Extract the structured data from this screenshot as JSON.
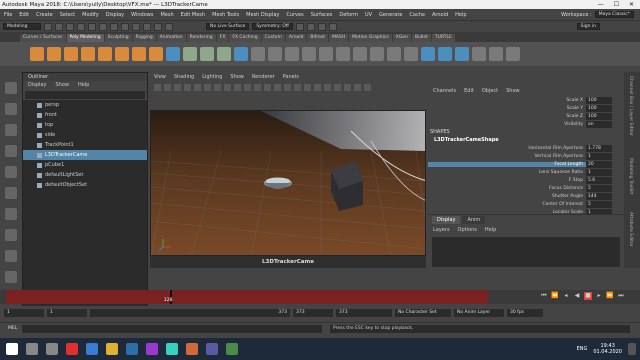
{
  "window_title": "Autodesk Maya 2018: C:\\Users\\yully\\Desktop\\VFX.ma*  ---  L3DTrackerCame",
  "window_controls": [
    "—",
    "☐",
    "✕"
  ],
  "menus": [
    "File",
    "Edit",
    "Create",
    "Select",
    "Modify",
    "Display",
    "Windows",
    "Mesh",
    "Edit Mesh",
    "Mesh Tools",
    "Mesh Display",
    "Curves",
    "Surfaces",
    "Deform",
    "UV",
    "Generate",
    "Cache",
    "Arnold",
    "Help"
  ],
  "workspace_label": "Workspace :",
  "workspace_value": "Maya Classic*",
  "mode_select": "Modeling",
  "live_surface": "No Live Surface",
  "symmetry": "Symmetry: Off",
  "signin": "Sign in",
  "shelf_tabs": [
    "Curves / Surfaces",
    "Poly Modeling",
    "Sculpting",
    "Rigging",
    "Animation",
    "Rendering",
    "FX",
    "FX Caching",
    "Custom",
    "Arnold",
    "Bifrost",
    "MASH",
    "Motion Graphics",
    "XGen",
    "Bullet",
    "TURTLE"
  ],
  "shelf_active": "Poly Modeling",
  "outliner": {
    "title": "Outliner",
    "menu": [
      "Display",
      "Show",
      "Help"
    ],
    "items": [
      {
        "label": "persp",
        "selected": false
      },
      {
        "label": "front",
        "selected": false
      },
      {
        "label": "top",
        "selected": false
      },
      {
        "label": "side",
        "selected": false
      },
      {
        "label": "TrackPoint1",
        "selected": false
      },
      {
        "label": "L3DTrackerCame",
        "selected": true
      },
      {
        "label": "pCube1",
        "selected": false
      },
      {
        "label": "defaultLightSet",
        "selected": false
      },
      {
        "label": "defaultObjectSet",
        "selected": false
      }
    ]
  },
  "viewport": {
    "menu": [
      "View",
      "Shading",
      "Lighting",
      "Show",
      "Renderer",
      "Panels"
    ],
    "camera_label": "L3DTrackerCame"
  },
  "channel_box": {
    "menu": [
      "Channels",
      "Edit",
      "Object",
      "Show"
    ],
    "transform_rows": [
      {
        "label": "Scale X",
        "value": "100"
      },
      {
        "label": "Scale Y",
        "value": "100"
      },
      {
        "label": "Scale Z",
        "value": "100"
      },
      {
        "label": "Visibility",
        "value": "on"
      }
    ],
    "shapes_label": "SHAPES",
    "shape_node": "L3DTrackerCameShape",
    "shape_rows": [
      {
        "label": "Horizontal Film Aperture",
        "value": "1.778",
        "hl": false
      },
      {
        "label": "Vertical Film Aperture",
        "value": "1",
        "hl": false
      },
      {
        "label": "Focal Length",
        "value": "20",
        "hl": true
      },
      {
        "label": "Lens Squeeze Ratio",
        "value": "1",
        "hl": false
      },
      {
        "label": "F Stop",
        "value": "5.6",
        "hl": false
      },
      {
        "label": "Focus Distance",
        "value": "5",
        "hl": false
      },
      {
        "label": "Shutter Angle",
        "value": "144",
        "hl": false
      },
      {
        "label": "Center Of Interest",
        "value": "5",
        "hl": false
      },
      {
        "label": "Locator Scale",
        "value": "1",
        "hl": false
      }
    ]
  },
  "layer_panel": {
    "tabs": [
      "Display",
      "Anim"
    ],
    "menu": [
      "Layers",
      "Options",
      "Help"
    ]
  },
  "side_tabs": [
    "Channel Box / Layer Editor",
    "Modeling Toolkit",
    "Attribute Editor"
  ],
  "timeline": {
    "current_frame": "128",
    "current_frame_fraction": 0.34,
    "start": "1",
    "end": "373"
  },
  "range": {
    "start": "1",
    "start_inner": "1",
    "end_inner": "373",
    "end": "373",
    "char_set": "No Character Set",
    "anim_layer": "No Anim Layer",
    "fps": "30 fps"
  },
  "command_line": {
    "label": "MEL",
    "message": "Press the ESC key to stop playback."
  },
  "taskbar": {
    "lang": "ENG",
    "time": "19:43",
    "date": "01.04.2020"
  }
}
